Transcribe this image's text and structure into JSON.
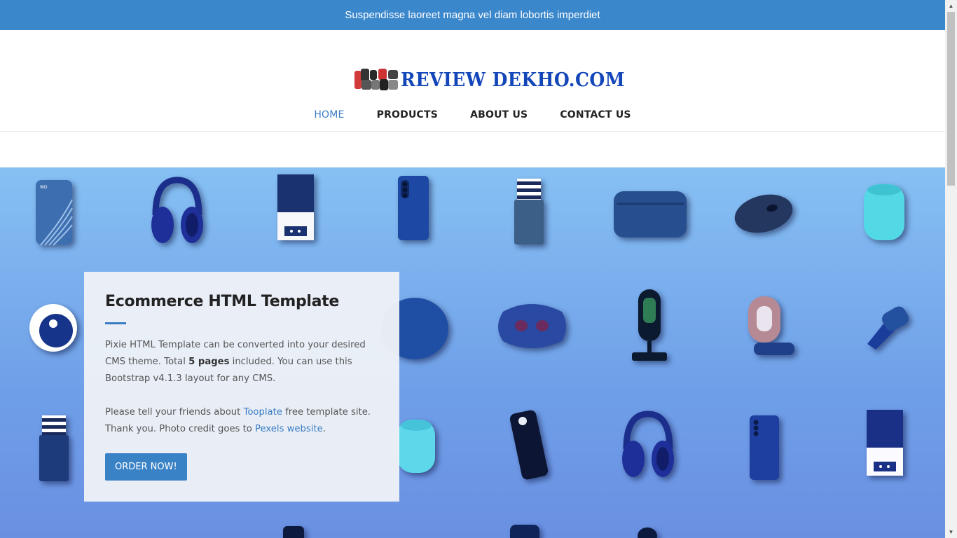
{
  "announcement": "Suspendisse laoreet magna vel diam lobortis imperdiet",
  "logo": {
    "text": "REVIEW DEKHO.COM"
  },
  "nav": {
    "items": [
      {
        "label": "HOME",
        "active": true
      },
      {
        "label": "PRODUCTS",
        "active": false
      },
      {
        "label": "ABOUT US",
        "active": false
      },
      {
        "label": "CONTACT US",
        "active": false
      }
    ]
  },
  "hero_card": {
    "title": "Ecommerce HTML Template",
    "p1_a": "Pixie HTML Template can be converted into your desired CMS theme. Total ",
    "p1_bold": "5 pages",
    "p1_b": " included. You can use this Bootstrap v4.1.3 layout for any CMS.",
    "p2_a": "Please tell your friends about ",
    "p2_link1": "Tooplate",
    "p2_b": " free template site. Thank you. Photo credit goes to ",
    "p2_link2": "Pexels website",
    "p2_c": ".",
    "button": "ORDER NOW!"
  },
  "products_row1": [
    "hard-drive-icon",
    "headphones-icon",
    "printer-icon",
    "smartphone-icon",
    "card-wallet-icon",
    "pouch-icon",
    "mouse-icon",
    "speaker-icon"
  ],
  "products_row2": [
    "airtag-icon",
    "smart-speaker-icon",
    "massager-icon",
    "microphone-icon",
    "phone-ring-stand-icon",
    "car-charger-icon"
  ],
  "products_row3": [
    "card-wallet-icon",
    "speaker-icon",
    "smartphone-icon",
    "headphones-icon",
    "smartphone-icon",
    "printer-icon"
  ],
  "colors": {
    "accent": "#3a87cb",
    "logo": "#1346b8",
    "hero_top": "#86c0f3",
    "hero_bottom": "#6a90e2"
  }
}
